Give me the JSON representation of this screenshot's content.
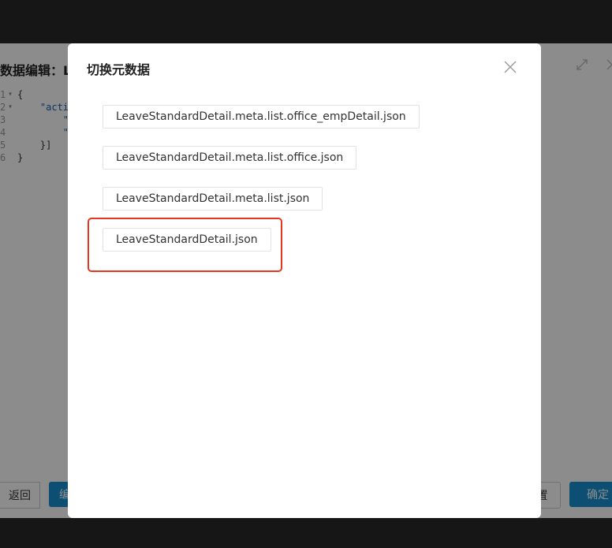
{
  "editor": {
    "title": "数据编辑：Le",
    "code_lines": [
      {
        "num": "1",
        "fold": "▾",
        "text": "{"
      },
      {
        "num": "2",
        "fold": "▾",
        "text": "    \"acti"
      },
      {
        "num": "3",
        "fold": "",
        "text": "        \""
      },
      {
        "num": "4",
        "fold": "",
        "text": "        \""
      },
      {
        "num": "5",
        "fold": "",
        "text": "    }]"
      },
      {
        "num": "6",
        "fold": "",
        "text": "}"
      }
    ],
    "back_label": "返回",
    "left_primary_label": "编",
    "reset_label": "置",
    "confirm_label": "确定",
    "expand_icon": "expand-icon",
    "close_icon": "close-icon"
  },
  "modal": {
    "title": "切换元数据",
    "close_icon": "close-icon",
    "files": [
      "LeaveStandardDetail.meta.list.office_empDetail.json",
      "LeaveStandardDetail.meta.list.office.json",
      "LeaveStandardDetail.meta.list.json",
      "LeaveStandardDetail.json"
    ],
    "highlight_color": "#e8351f"
  },
  "colors": {
    "primary": "#1890d0",
    "backdrop": "#161616"
  }
}
